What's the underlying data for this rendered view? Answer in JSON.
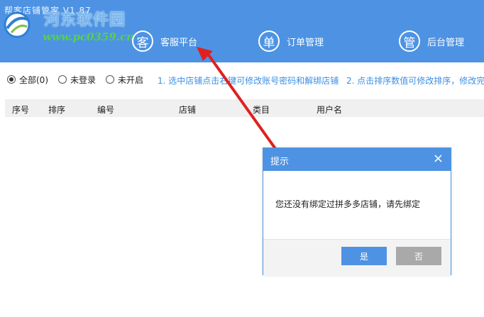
{
  "header": {
    "app_title": "帮客店铺管家 V1.87",
    "watermark_text": "河东软件园",
    "watermark_url": "www.pc0359.cn",
    "nav": [
      {
        "icon": "客",
        "label": "客服平台"
      },
      {
        "icon": "单",
        "label": "订单管理"
      },
      {
        "icon": "管",
        "label": "后台管理"
      }
    ]
  },
  "filters": {
    "options": [
      {
        "label": "全部(0)",
        "selected": true
      },
      {
        "label": "未登录",
        "selected": false
      },
      {
        "label": "未开启",
        "selected": false
      }
    ],
    "hint1": "1. 选中店铺点击右键可修改账号密码和解绑店铺",
    "hint2": "2. 点击排序数值可修改排序，修改完"
  },
  "table": {
    "columns": [
      "序号",
      "排序",
      "编号",
      "店铺",
      "类目",
      "用户名"
    ]
  },
  "dialog": {
    "title": "提示",
    "close": "×",
    "message": "您还没有绑定过拼多多店铺，请先绑定",
    "yes": "是",
    "no": "否"
  },
  "colors": {
    "accent": "#4e93e3",
    "arrow": "#e02020",
    "hint": "#3b8fe3"
  }
}
